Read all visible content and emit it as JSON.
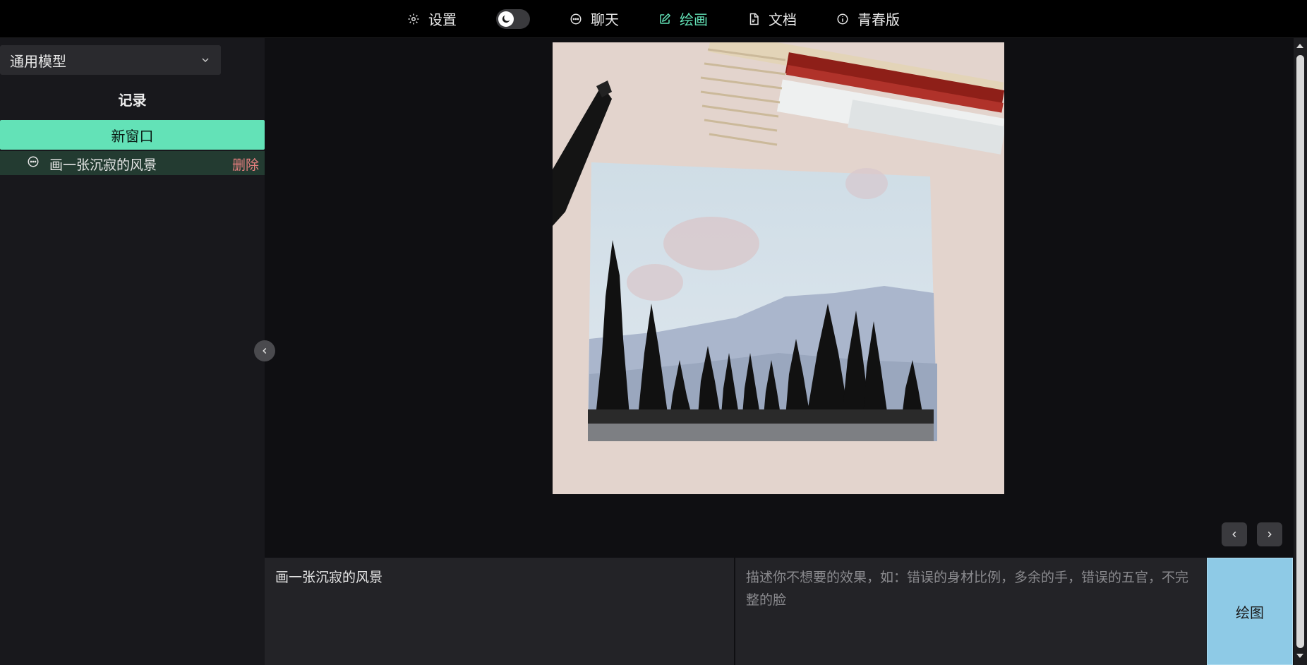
{
  "nav": {
    "settings": "设置",
    "chat": "聊天",
    "draw": "绘画",
    "docs": "文档",
    "youth": "青春版"
  },
  "sidebar": {
    "model": "通用模型",
    "records_title": "记录",
    "new_window": "新窗口",
    "records": [
      {
        "label": "画一张沉寂的风景",
        "delete_label": "删除"
      }
    ]
  },
  "input": {
    "prompt_value": "画一张沉寂的风景",
    "negative_placeholder": "描述你不想要的效果，如：错误的身材比例，多余的手，错误的五官，不完整的脸",
    "draw_button": "绘图"
  },
  "colors": {
    "accent": "#63e2b7",
    "draw_button": "#8ecae6",
    "delete": "#e88080"
  }
}
